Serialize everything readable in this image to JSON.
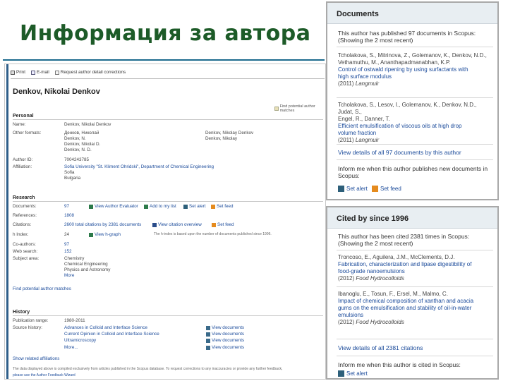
{
  "slide": {
    "title": "Информация за автора"
  },
  "toolbar": {
    "print": "Print",
    "email": "E-mail",
    "request": "Request author detail corrections"
  },
  "author": {
    "name": "Denkov, Nikolai Denkov",
    "potential_matches": "Find potential author matches"
  },
  "personal": {
    "heading": "Personal",
    "name_label": "Name:",
    "name_value": "Denkov, Nikolai Denkov",
    "other_formats_label": "Other formats:",
    "other_formats": [
      "Денков, Николай",
      "Denkov, N.",
      "Denkov, Nikolai D.",
      "Denkov, N. D."
    ],
    "other_formats_right": [
      "Denkov, Nikolay Denkov",
      "Denkov, Nikolay"
    ],
    "author_id_label": "Author ID:",
    "author_id_value": "7004243785",
    "affiliation_label": "Affiliation:",
    "affiliation_lines": [
      "Sofia University \"St. Kliment Ohridski\", Department of Chemical Engineering",
      "Sofia",
      "Bulgaria"
    ]
  },
  "research": {
    "heading": "Research",
    "documents_label": "Documents:",
    "documents_value": "97",
    "view_author_evaluator": "View Author Evaluator",
    "add_to_my_list": "Add to my list",
    "set_alert": "Set alert",
    "set_feed": "Set feed",
    "references_label": "References:",
    "references_value": "1808",
    "citations_label": "Citations:",
    "citations_value": "2600 total citations by 2381 documents",
    "view_citation_overview": "View citation overview",
    "set_feed2": "Set feed",
    "hindex_label": "h Index:",
    "hindex_value": "24",
    "view_hgraph": "View h-graph",
    "hindex_note": "The h-index is based upon the number of documents published since 1996.",
    "coauthors_label": "Co-authors:",
    "coauthors_value": "97",
    "websearch_label": "Web search:",
    "websearch_value": "152",
    "subject_label": "Subject area:",
    "subject_lines": [
      "Chemistry",
      "Chemical Engineering",
      "Physics and Astronomy",
      "More"
    ]
  },
  "find_potential": "Find potential author matches",
  "history": {
    "heading": "History",
    "pub_range_label": "Publication range:",
    "pub_range_value": "1980-2011",
    "source_label": "Source history:",
    "sources": [
      "Advances in Colloid and Interface Science",
      "Current Opinion in Colloid and Interface Science",
      "Ultramicroscopy",
      "More..."
    ],
    "view_docs": "View documents",
    "show_related": "Show related affiliations"
  },
  "footer": {
    "note": "The data displayed above is compiled exclusively from articles published in the Scopus database. To request corrections to any inaccuracies or provide any further feedback,",
    "link": "please use the Author Feedback Wizard"
  },
  "documents_panel": {
    "title": "Documents",
    "summary_line1": "This author has published 97 documents in Scopus:",
    "summary_line2": "(Showing the 2 most recent)",
    "items": [
      {
        "authors": [
          "Tcholakova, S., Mitrinova, Z., Golemanov, K., Denkov, N.D.,",
          "Vethamuthu, M., Ananthapadmanabhan, K.P."
        ],
        "title": [
          "Control of ostwald ripening by using surfactants with",
          "high surface modulus"
        ],
        "source_year": "(2011)",
        "source_name": "Langmuir"
      },
      {
        "authors": [
          "Tcholakova, S., Lesov, I., Golemanov, K., Denkov, N.D., Judat, S.,",
          "Engel, R., Danner, T."
        ],
        "title": [
          "Efficient emulsification of viscous oils at high drop",
          "volume fraction"
        ],
        "source_year": "(2011)",
        "source_name": "Langmuir"
      }
    ],
    "view_all": "View details of all 97 documents by this author",
    "inform_line1": "Inform me when this author publishes new documents in",
    "inform_line2": "Scopus:",
    "set_alert": "Set alert",
    "set_feed": "Set feed"
  },
  "cited_panel": {
    "title": "Cited by since 1996",
    "summary_line1": "This author has been cited 2381 times in Scopus:",
    "summary_line2": "(Showing the 2 most recent)",
    "items": [
      {
        "authors": [
          "Troncoso, E., Aguilera, J.M., McClements, D.J."
        ],
        "title": [
          "Fabrication, characterization and lipase digestibility of",
          "food-grade nanoemulsions"
        ],
        "source_year": "(2012)",
        "source_name": "Food Hydrocolloids"
      },
      {
        "authors": [
          "Ibanoglu, E., Tosun, F., Ersel, M., Malmo, C."
        ],
        "title": [
          "Impact of chemical composition of xanthan and acacia",
          "gums on the emulsification and stability of oil-in-water",
          "emulsions"
        ],
        "source_year": "(2012)",
        "source_name": "Food Hydrocolloids"
      }
    ],
    "view_all": "View details of all 2381 citations",
    "inform_line1": "Inform me when this author is cited in Scopus:",
    "set_alert": "Set alert"
  }
}
